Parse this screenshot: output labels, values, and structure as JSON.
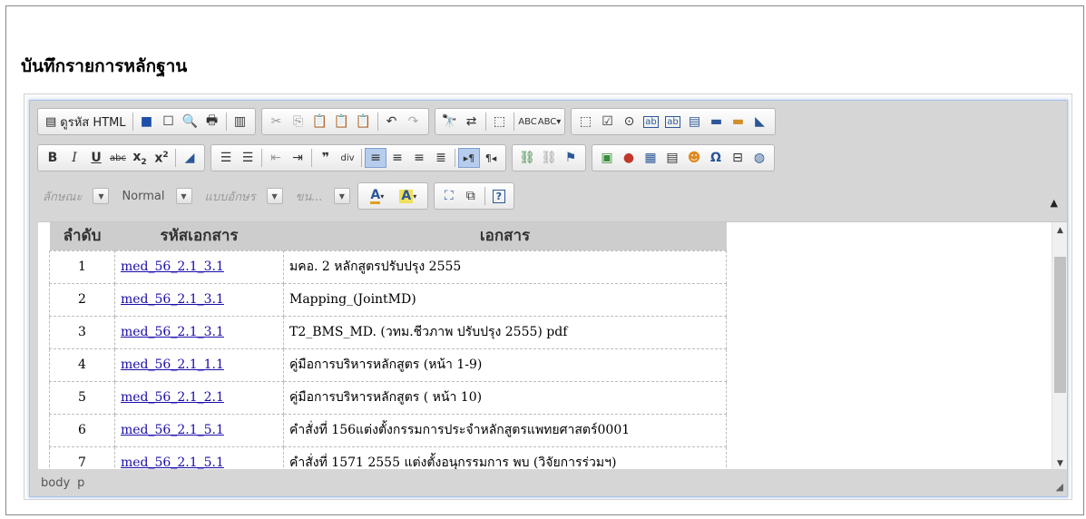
{
  "page": {
    "title": "บันทึกรายการหลักฐาน"
  },
  "toolbar": {
    "source_label": "ดูรหัส HTML",
    "format_placeholder": "ลักษณะ",
    "style_value": "Normal",
    "font_placeholder": "แบบอักษร",
    "size_placeholder": "ขน..."
  },
  "table": {
    "headers": [
      "ลำดับ",
      "รหัสเอกสาร",
      "เอกสาร"
    ],
    "rows": [
      {
        "num": "1",
        "code": "med_56_2.1_3.1",
        "doc": "มคอ. 2 หลักสูตรปรับปรุง 2555"
      },
      {
        "num": "2",
        "code": "med_56_2.1_3.1",
        "doc": "Mapping_(JointMD)"
      },
      {
        "num": "3",
        "code": "med_56_2.1_3.1",
        "doc": "T2_BMS_MD. (วทม.ชีวภาพ ปรับปรุง 2555) pdf"
      },
      {
        "num": "4",
        "code": "med_56_2.1_1.1",
        "doc": "คู่มือการบริหารหลักสูตร (หน้า 1-9)"
      },
      {
        "num": "5",
        "code": "med_56_2.1_2.1",
        "doc": "คู่มือการบริหารหลักสูตร ( หน้า 10)"
      },
      {
        "num": "6",
        "code": "med_56_2.1_5.1",
        "doc": "คำสั่งที่ 156แต่งตั้งกรรมการประจำหลักสูตรแพทยศาสตร์0001"
      },
      {
        "num": "7",
        "code": "med_56_2.1_5.1",
        "doc": "คำสั่งที่ 1571 2555 แต่งตั้งอนุกรรมการ พบ (วิจัยการร่วมฯ)"
      }
    ]
  },
  "status_bar": {
    "path": [
      "body",
      "p"
    ]
  }
}
